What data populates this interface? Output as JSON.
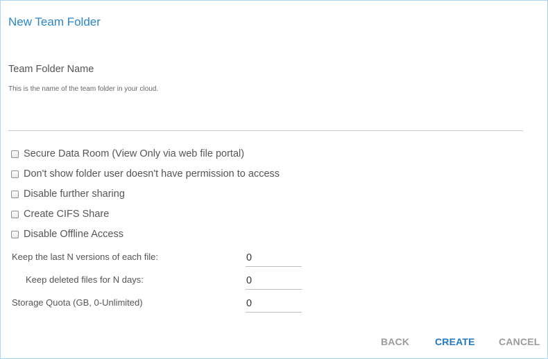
{
  "dialog": {
    "title": "New Team Folder"
  },
  "folder_name": {
    "label": "Team Folder Name",
    "help": "This is the name of the team folder in your cloud.",
    "value": ""
  },
  "options": [
    {
      "label": "Secure Data Room (View Only via web file portal)",
      "checked": false
    },
    {
      "label": "Don't show folder user doesn't have permission to access",
      "checked": false
    },
    {
      "label": "Disable further sharing",
      "checked": false
    },
    {
      "label": "Create CIFS Share",
      "checked": false
    },
    {
      "label": "Disable Offline Access",
      "checked": false
    }
  ],
  "numeric_fields": [
    {
      "label": "Keep the last N versions of each file:",
      "value": "0"
    },
    {
      "label": "Keep deleted files for N days:",
      "value": "0"
    },
    {
      "label": "Storage Quota (GB, 0-Unlimited)",
      "value": "0"
    }
  ],
  "buttons": {
    "back": "BACK",
    "create": "CREATE",
    "cancel": "CANCEL"
  },
  "colors": {
    "accent": "#2a86c6",
    "primary_button": "#1f78c1",
    "secondary_button": "#9a9a9a",
    "border": "#a9d6f0"
  }
}
